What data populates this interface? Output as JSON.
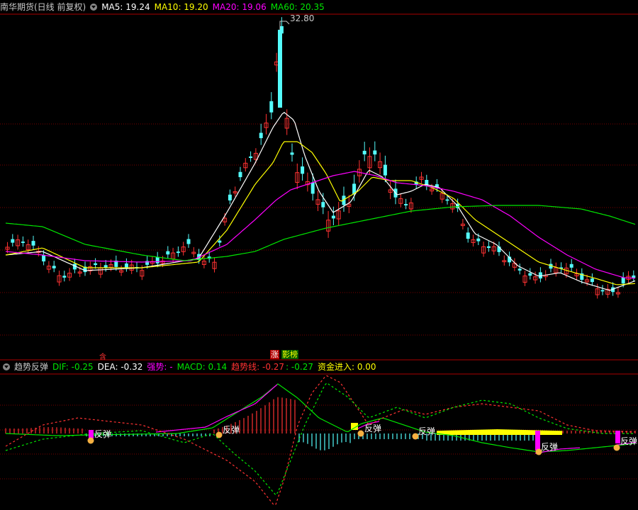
{
  "main_header": {
    "title": "南华期货(日线 前复权)",
    "ma5": "MA5: 19.24",
    "ma10": "MA10: 19.20",
    "ma20": "MA20: 19.06",
    "ma60": "MA60: 20.35"
  },
  "sub_header": {
    "title": "趋势反弹",
    "dif": "DIF: -0.25",
    "dea": "DEA: -0.32",
    "strong": "强势: -",
    "macd": "MACD: 0.14",
    "trend": "趋势线: -0.27",
    "trend2": ": -0.27",
    "fund": "资金进入: 0.00"
  },
  "labels": {
    "high_price": "32.80",
    "marker_small": "含",
    "zhang": "涨",
    "yingbang": "影榜",
    "rebound": "反弹"
  },
  "colors": {
    "up": "#ff3232",
    "down": "#54fcfc",
    "ma5": "#ffffff",
    "ma10": "#ffff00",
    "ma20": "#ff00ff",
    "ma60": "#00e600",
    "grid": "#7a0000",
    "yellow_bar": "#ffff00"
  },
  "chart_data": {
    "type": "candlestick",
    "high": 32.8,
    "ma_values": {
      "MA5": 19.24,
      "MA10": 19.2,
      "MA20": 19.06,
      "MA60": 20.35
    },
    "indicator": {
      "DIF": -0.25,
      "DEA": -0.32,
      "MACD": 0.14,
      "trend_line": -0.27,
      "fund_inflow": 0.0
    }
  }
}
